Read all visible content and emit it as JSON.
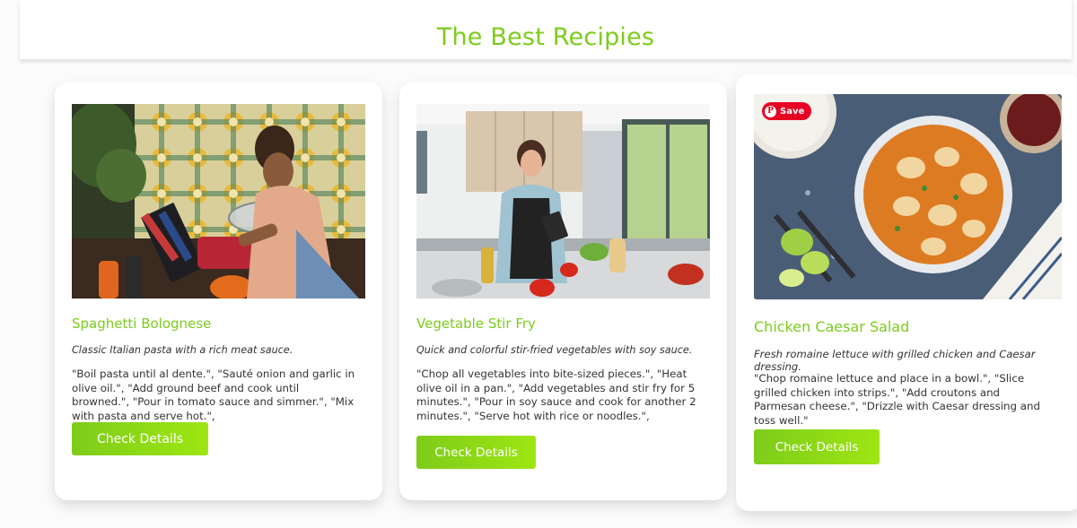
{
  "header": {
    "title": "The Best Recipies"
  },
  "recipes": [
    {
      "title": "Spaghetti Bolognese",
      "image": "woman-cooking-pasta-in-tiled-kitchen",
      "description": "Classic Italian pasta with a rich meat sauce.",
      "steps": "\"Boil pasta until al dente.\", \"Sauté onion and garlic in olive oil.\", \"Add ground beef and cook until browned.\", \"Pour in tomato sauce and simmer.\", \"Mix with pasta and serve hot.\",",
      "button": "Check Details"
    },
    {
      "title": "Vegetable Stir Fry",
      "image": "woman-with-tablet-in-modern-kitchen",
      "description": "Quick and colorful stir-fried vegetables with soy sauce.",
      "steps": "\"Chop all vegetables into bite-sized pieces.\", \"Heat olive oil in a pan.\", \"Add vegetables and stir fry for 5 minutes.\", \"Pour in soy sauce and cook for another 2 minutes.\", \"Serve hot with rice or noodles.\",",
      "button": "Check Details"
    },
    {
      "title": "Chicken Caesar Salad",
      "image": "chicken-curry-bowl-with-rice",
      "save_label": "Save",
      "description": "Fresh romaine lettuce with grilled chicken and Caesar dressing.",
      "steps": "\"Chop romaine lettuce and place in a bowl.\", \"Slice grilled chicken into strips.\", \"Add croutons and Parmesan cheese.\", \"Drizzle with Caesar dressing and toss well.\"",
      "button": "Check Details"
    }
  ],
  "colors": {
    "accent": "#7ccc1c",
    "button_start": "#7dcc1a",
    "button_end": "#9ee612",
    "pinterest": "#e60023"
  }
}
